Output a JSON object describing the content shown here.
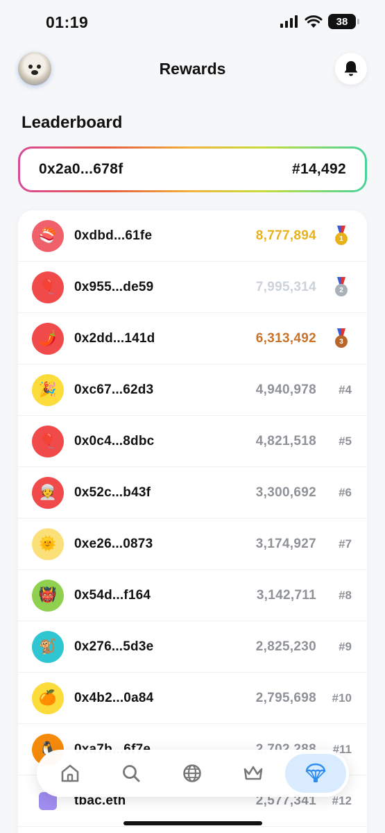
{
  "status_bar": {
    "time": "01:19",
    "battery": "38"
  },
  "header": {
    "title": "Rewards"
  },
  "leaderboard": {
    "section_title": "Leaderboard",
    "my_entry": {
      "address": "0x2a0...678f",
      "rank": "#14,492"
    },
    "rows": [
      {
        "emoji": "🍣",
        "bg": "#f0606a",
        "address": "0xdbd...61fe",
        "score": "8,777,894",
        "score_color": "#e8b21b",
        "medal": "gold",
        "medal_label": "1",
        "rank": ""
      },
      {
        "emoji": "🎈",
        "bg": "#f04a4a",
        "address": "0x955...de59",
        "score": "7,995,314",
        "score_color": "#ccd2d9",
        "medal": "silver",
        "medal_label": "2",
        "rank": ""
      },
      {
        "emoji": "🌶️",
        "bg": "#f04a4a",
        "address": "0x2dd...141d",
        "score": "6,313,492",
        "score_color": "#c8742a",
        "medal": "bronze",
        "medal_label": "3",
        "rank": ""
      },
      {
        "emoji": "🎉",
        "bg": "#fbdc3b",
        "address": "0xc67...62d3",
        "score": "4,940,978",
        "rank": "#4"
      },
      {
        "emoji": "🎈",
        "bg": "#f04a4a",
        "address": "0x0c4...8dbc",
        "score": "4,821,518",
        "rank": "#5"
      },
      {
        "emoji": "👳",
        "bg": "#f04a4a",
        "address": "0x52c...b43f",
        "score": "3,300,692",
        "rank": "#6"
      },
      {
        "emoji": "🌞",
        "bg": "#fbe07a",
        "address": "0xe26...0873",
        "score": "3,174,927",
        "rank": "#7"
      },
      {
        "emoji": "👹",
        "bg": "#8fd14f",
        "address": "0x54d...f164",
        "score": "3,142,711",
        "rank": "#8"
      },
      {
        "emoji": "🐒",
        "bg": "#2fc6d1",
        "address": "0x276...5d3e",
        "score": "2,825,230",
        "rank": "#9"
      },
      {
        "emoji": "🍊",
        "bg": "#fbdc3b",
        "address": "0x4b2...0a84",
        "score": "2,795,698",
        "rank": "#10"
      },
      {
        "emoji": "🐧",
        "bg": "#f58a0b",
        "address": "0xa7b...6f7e",
        "score": "2,702,288",
        "rank": "#11"
      },
      {
        "emoji": "",
        "bg": "#9f8df0",
        "address": "tbac.eth",
        "score": "2,577,341",
        "rank": "#12"
      }
    ]
  },
  "bottom_nav": {
    "items": [
      {
        "name": "home-icon"
      },
      {
        "name": "search-icon"
      },
      {
        "name": "globe-icon"
      },
      {
        "name": "crown-icon"
      },
      {
        "name": "parachute-icon",
        "active": true
      }
    ]
  },
  "colors": {
    "accent": "#2f8cf0",
    "active_tab_bg": "#d8ebff"
  }
}
